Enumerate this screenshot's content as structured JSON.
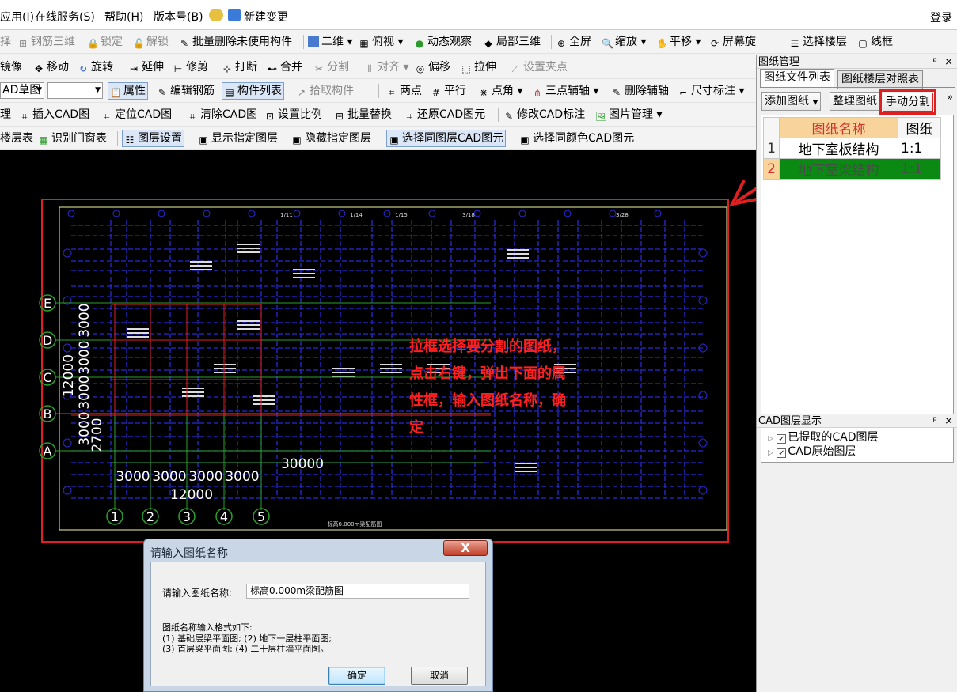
{
  "menu": {
    "items": [
      "应用(I)",
      "在线服务(S)",
      "帮助(H)",
      "版本号(B)",
      "新建变更"
    ],
    "login": "登录"
  },
  "toolbar": {
    "row1": [
      "择",
      "钢筋三维",
      "锁定",
      "解锁",
      "批量删除未使用构件",
      "二维",
      "俯视",
      "动态观察",
      "局部三维",
      "全屏",
      "缩放",
      "平移",
      "屏幕旋转",
      "选择楼层",
      "线框"
    ],
    "row2": [
      "镜像",
      "移动",
      "旋转",
      "延伸",
      "修剪",
      "打断",
      "合并",
      "分割",
      "对齐",
      "偏移",
      "拉伸",
      "设置夹点"
    ],
    "row3": {
      "combo1": "AD草图",
      "combo2": "",
      "items": [
        "属性",
        "编辑钢筋",
        "构件列表",
        "拾取构件",
        "两点",
        "平行",
        "点角",
        "三点辅轴",
        "删除辅轴",
        "尺寸标注"
      ]
    },
    "row4": [
      "理",
      "插入CAD图",
      "定位CAD图",
      "清除CAD图",
      "设置比例",
      "批量替换",
      "还原CAD图元",
      "修改CAD标注",
      "图片管理"
    ],
    "row5": [
      "楼层表",
      "识别门窗表",
      "图层设置",
      "显示指定图层",
      "隐藏指定图层",
      "选择同图层CAD图元",
      "选择同颜色CAD图元"
    ]
  },
  "canvas": {
    "note": "拉框选择要分割的图纸，点击右键，弹出下面的属性框，输入图纸名称，确定",
    "axis_rows": [
      "E",
      "D",
      "C",
      "B",
      "A"
    ],
    "axis_cols": [
      "1",
      "2",
      "3",
      "4",
      "5"
    ],
    "dims_vertical": [
      "3000",
      "3000",
      "3000",
      "3000",
      "2700",
      "12000"
    ],
    "dims_horizontal": [
      "3000",
      "3000",
      "3000",
      "3000",
      "12000",
      "30000"
    ],
    "top_labels": [
      "1/11",
      "1/14",
      "1/15",
      "3/18",
      "3/28"
    ],
    "drawing_title": "标高0.000m梁配筋图"
  },
  "panel": {
    "title": "图纸管理",
    "pin": "ᵖ",
    "close": "×",
    "tabs": [
      "图纸文件列表",
      "图纸楼层对照表"
    ],
    "buttons": {
      "add": "添加图纸",
      "arrange": "整理图纸",
      "split": "手动分割",
      "more": "»"
    },
    "table": {
      "headers": [
        "图纸名称",
        "图纸"
      ],
      "rows": [
        {
          "no": "1",
          "name": "地下室板结构",
          "scale": "1:1"
        },
        {
          "no": "2",
          "name": "地下室梁结构",
          "scale": "1:1"
        }
      ]
    },
    "layers_title": "CAD图层显示",
    "layers": [
      "已提取的CAD图层",
      "CAD原始图层"
    ]
  },
  "dialog": {
    "title": "请输入图纸名称",
    "close": "X",
    "label": "请输入图纸名称:",
    "value": "标高0.000m梁配筋图",
    "help_title": "图纸名称输入格式如下:",
    "help1": "(1) 基础层梁平面图; (2) 地下一层柱平面图;",
    "help2": "(3) 首层梁平面图;    (4) 二十层柱墙平面图。",
    "ok": "确定",
    "cancel": "取消"
  },
  "colors": {
    "annotation": "#ff2020",
    "selected_row": "#0a8a12",
    "header": "#f8d39a",
    "cad_blue": "#2a2ad8",
    "cad_red": "#e02020"
  }
}
